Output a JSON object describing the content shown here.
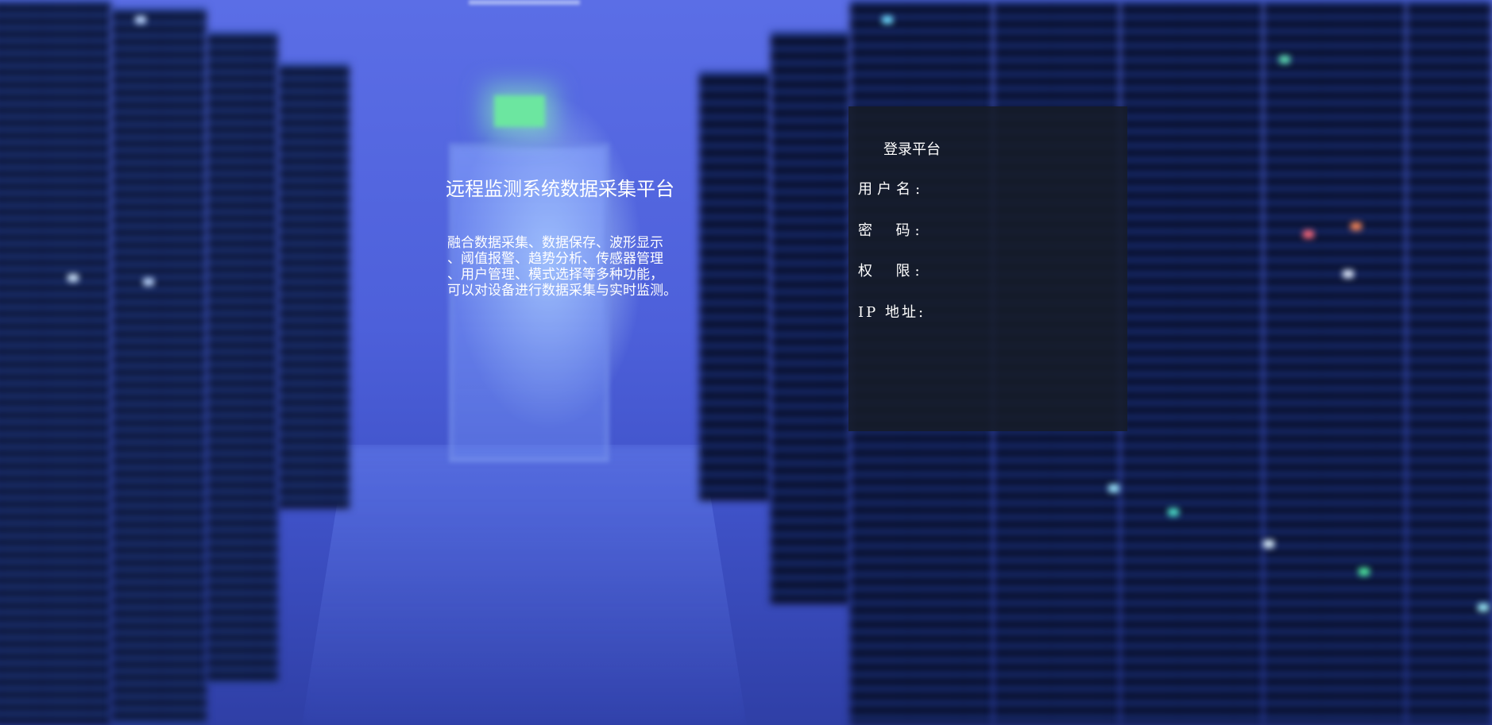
{
  "hero": {
    "title": "远程监测系统数据采集平台",
    "description_lines": [
      "融合数据采集、数据保存、波形显示",
      "、阈值报警、趋势分析、传感器管理",
      "、用户管理、模式选择等多种功能，",
      "可以对设备进行数据采集与实时监测。"
    ]
  },
  "login": {
    "title": "登录平台",
    "fields": [
      {
        "label": "用户名:",
        "value": ""
      },
      {
        "label": "密  码:",
        "value": ""
      },
      {
        "label": "权  限:",
        "value": ""
      },
      {
        "label": "IP 地址:",
        "value": ""
      }
    ]
  },
  "colors": {
    "panel_bg": "#161c28",
    "text": "#ffffff",
    "background_accent": "#4d60da"
  }
}
